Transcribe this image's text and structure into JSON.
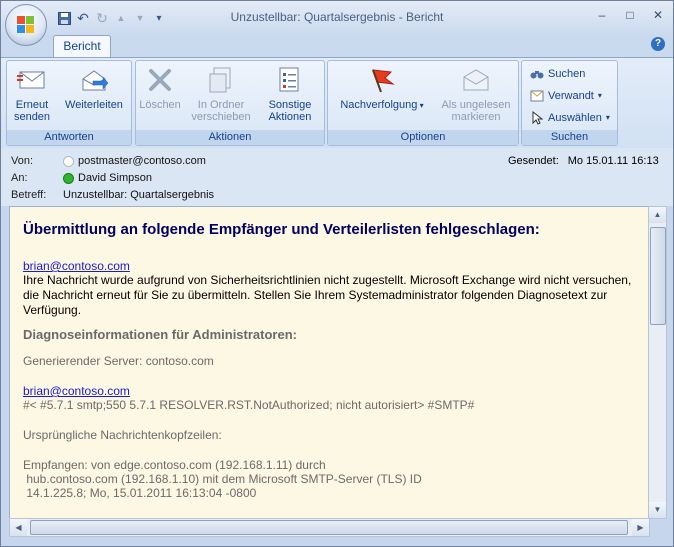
{
  "window": {
    "title": "Unzustellbar: Quartalsergebnis - Bericht",
    "minimize": "–",
    "maximize": "□",
    "close": "✕"
  },
  "quick_access": [
    {
      "name": "save-icon",
      "glyph": "💾"
    },
    {
      "name": "undo-icon",
      "glyph": "↶"
    },
    {
      "name": "redo-icon",
      "glyph": "↷"
    },
    {
      "name": "previous-item-icon",
      "glyph": "▲"
    },
    {
      "name": "next-item-icon",
      "glyph": "▼"
    },
    {
      "name": "customize-toolbar-icon",
      "glyph": "▾"
    }
  ],
  "tabs": {
    "active": "Bericht"
  },
  "help_glyph": "?",
  "ribbon": {
    "antworten": {
      "label": "Antworten",
      "resend": "Erneut\nsenden",
      "forward": "Weiterleiten"
    },
    "aktionen": {
      "label": "Aktionen",
      "delete": "Löschen",
      "move": "In Ordner\nverschieben",
      "other": "Sonstige\nAktionen"
    },
    "optionen": {
      "label": "Optionen",
      "followup": "Nachverfolgung",
      "mark_unread": "Als ungelesen\nmarkieren"
    },
    "suchen": {
      "label": "Suchen",
      "find": "Suchen",
      "related": "Verwandt",
      "select": "Auswählen"
    }
  },
  "header": {
    "from_label": "Von:",
    "from_value": "postmaster@contoso.com",
    "to_label": "An:",
    "to_value": "David Simpson",
    "subject_label": "Betreff:",
    "subject_value": "Unzustellbar: Quartalsergebnis",
    "sent_label": "Gesendet:",
    "sent_value": "Mo 15.01.11 16:13",
    "presence_online_color": "#2fb52f",
    "presence_unknown_color": "#ffffff"
  },
  "message": {
    "heading": "Übermittlung an folgende Empfänger und Verteilerlisten fehlgeschlagen:",
    "recipient_link": "brian@contoso.com",
    "explanation": "Ihre Nachricht wurde aufgrund von Sicherheitsrichtlinien nicht zugestellt. Microsoft Exchange wird nicht versuchen, die Nachricht erneut für Sie zu übermitteln. Stellen Sie Ihrem Systemadministrator folgenden Diagnosetext zur Verfügung.",
    "diag_heading": "Diagnoseinformationen für Administratoren:",
    "generating_server": "Generierender Server: contoso.com",
    "diag_link": "brian@contoso.com",
    "diag_code": "#< #5.7.1 smtp;550 5.7.1 RESOLVER.RST.NotAuthorized; nicht autorisiert> #SMTP#",
    "original_headers_label": "Ursprüngliche Nachrichtenkopfzeilen:",
    "received_line1": "Empfangen: von edge.contoso.com (192.168.1.11) durch",
    "received_line2": " hub.contoso.com (192.168.1.10) mit dem Microsoft SMTP-Server (TLS) ID",
    "received_line3": " 14.1.225.8; Mo, 15.01.2011 16:13:04 -0800"
  }
}
